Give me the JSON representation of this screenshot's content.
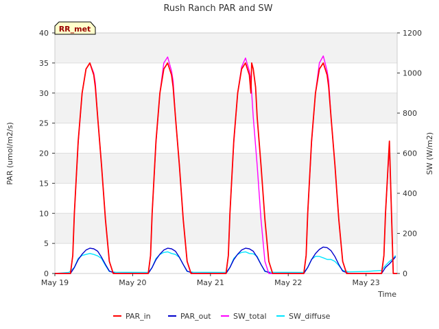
{
  "chart_data": {
    "type": "line",
    "title": "Rush Ranch PAR and SW",
    "station_badge": "RR_met",
    "xlabel": "Time",
    "ylabel_left": "PAR (umol/m2/s)",
    "ylabel_right": "SW (W/m2)",
    "xlim": [
      0,
      4.4
    ],
    "ylim_left": [
      0,
      40
    ],
    "ylim_right": [
      0,
      1200
    ],
    "x_ticks": [
      {
        "value": 0,
        "label": "May 19"
      },
      {
        "value": 1,
        "label": "May 20"
      },
      {
        "value": 2,
        "label": "May 21"
      },
      {
        "value": 3,
        "label": "May 22"
      },
      {
        "value": 4,
        "label": "May 23"
      }
    ],
    "y_ticks_left": [
      0,
      5,
      10,
      15,
      20,
      25,
      30,
      35,
      40
    ],
    "y_ticks_right": [
      0,
      200,
      400,
      600,
      800,
      1000,
      1200
    ],
    "grid": true,
    "shaded_bands_left": [
      [
        5,
        10
      ],
      [
        15,
        20
      ],
      [
        25,
        30
      ],
      [
        35,
        40
      ]
    ],
    "legend_position": "bottom",
    "series": [
      {
        "name": "PAR_in",
        "color": "#ff0000",
        "axis": "left",
        "x": [
          0,
          0.2,
          0.23,
          0.25,
          0.3,
          0.35,
          0.4,
          0.45,
          0.5,
          0.52,
          0.55,
          0.6,
          0.65,
          0.7,
          0.75,
          0.8,
          0.82,
          1.2,
          1.23,
          1.25,
          1.3,
          1.35,
          1.4,
          1.45,
          1.5,
          1.52,
          1.55,
          1.6,
          1.65,
          1.7,
          1.75,
          1.8,
          1.82,
          2.2,
          2.23,
          2.25,
          2.3,
          2.35,
          2.4,
          2.45,
          2.5,
          2.52,
          2.53,
          2.55,
          2.58,
          2.6,
          2.65,
          2.7,
          2.75,
          2.8,
          2.82,
          3.2,
          3.23,
          3.25,
          3.3,
          3.35,
          3.4,
          3.45,
          3.5,
          3.52,
          3.55,
          3.6,
          3.65,
          3.7,
          3.75,
          3.8,
          3.82,
          4.2,
          4.23,
          4.25,
          4.3,
          4.35,
          4.4
        ],
        "y": [
          0,
          0,
          3,
          10,
          22,
          30,
          34,
          35,
          33,
          31,
          26,
          18,
          9,
          2,
          0,
          0,
          0,
          0,
          3,
          10,
          22,
          30,
          34,
          35,
          33,
          31,
          26,
          18,
          9,
          2,
          0,
          0,
          0,
          0,
          3,
          10,
          22,
          30,
          34,
          35,
          33,
          30,
          35,
          34,
          31,
          26,
          18,
          9,
          2,
          0,
          0,
          0,
          3,
          10,
          22,
          30,
          34,
          35,
          33,
          31,
          26,
          18,
          9,
          2,
          0,
          0,
          0,
          0,
          3,
          10,
          22,
          0,
          0
        ]
      },
      {
        "name": "PAR_out",
        "color": "#0000cc",
        "axis": "left",
        "x": [
          0,
          0.2,
          0.25,
          0.3,
          0.35,
          0.4,
          0.45,
          0.5,
          0.55,
          0.6,
          0.65,
          0.7,
          0.78,
          1.2,
          1.25,
          1.3,
          1.35,
          1.4,
          1.45,
          1.5,
          1.55,
          1.6,
          1.65,
          1.7,
          1.78,
          2.2,
          2.25,
          2.3,
          2.35,
          2.4,
          2.45,
          2.5,
          2.55,
          2.6,
          2.65,
          2.7,
          2.78,
          3.2,
          3.25,
          3.3,
          3.35,
          3.4,
          3.45,
          3.5,
          3.55,
          3.6,
          3.65,
          3.7,
          3.78,
          4.2,
          4.25,
          4.3,
          4.35,
          4.38
        ],
        "y": [
          0,
          0,
          1.0,
          2.3,
          3.2,
          3.9,
          4.2,
          4.1,
          3.7,
          2.7,
          1.5,
          0.4,
          0,
          0,
          1.0,
          2.3,
          3.2,
          3.9,
          4.2,
          4.1,
          3.7,
          2.7,
          1.5,
          0.4,
          0,
          0,
          1.0,
          2.3,
          3.2,
          3.9,
          4.2,
          4.1,
          3.7,
          2.7,
          1.5,
          0.4,
          0,
          0,
          1.0,
          2.3,
          3.3,
          4.0,
          4.4,
          4.3,
          3.8,
          2.8,
          1.5,
          0.4,
          0,
          0,
          1.0,
          1.6,
          2.3,
          2.8
        ]
      },
      {
        "name": "SW_total",
        "color": "#ff00ff",
        "axis": "right",
        "x": [
          0,
          0.2,
          0.23,
          0.25,
          0.3,
          0.35,
          0.4,
          0.45,
          0.5,
          0.52,
          0.55,
          0.6,
          0.65,
          0.7,
          0.75,
          0.8,
          0.82,
          1.2,
          1.23,
          1.25,
          1.3,
          1.35,
          1.4,
          1.45,
          1.5,
          1.52,
          1.55,
          1.6,
          1.65,
          1.7,
          1.75,
          1.8,
          1.82,
          2.2,
          2.23,
          2.25,
          2.3,
          2.35,
          2.4,
          2.45,
          2.5,
          2.52,
          2.55,
          2.6,
          2.65,
          2.7,
          2.75,
          2.8,
          2.82,
          3.2,
          3.23,
          3.25,
          3.3,
          3.35,
          3.4,
          3.45,
          3.5,
          3.52,
          3.55,
          3.6,
          3.65,
          3.7,
          3.75,
          3.8,
          3.82,
          4.2,
          4.23,
          4.25,
          4.3,
          4.35,
          4.4
        ],
        "y": [
          0,
          0,
          90,
          300,
          650,
          900,
          1020,
          1050,
          1000,
          950,
          780,
          540,
          270,
          60,
          0,
          0,
          0,
          0,
          90,
          300,
          650,
          900,
          1050,
          1080,
          1010,
          960,
          780,
          540,
          270,
          60,
          0,
          0,
          0,
          0,
          90,
          300,
          650,
          900,
          1030,
          1075,
          1010,
          960,
          780,
          540,
          270,
          60,
          0,
          0,
          0,
          0,
          90,
          300,
          650,
          900,
          1050,
          1085,
          1010,
          960,
          780,
          540,
          270,
          60,
          0,
          0,
          0,
          0,
          90,
          300,
          640,
          0,
          0
        ]
      },
      {
        "name": "SW_diffuse",
        "color": "#00e5ff",
        "axis": "right",
        "x": [
          0,
          0.18,
          0.25,
          0.3,
          0.35,
          0.4,
          0.45,
          0.5,
          0.55,
          0.6,
          0.65,
          0.7,
          0.78,
          1.2,
          1.25,
          1.3,
          1.35,
          1.4,
          1.45,
          1.5,
          1.55,
          1.6,
          1.65,
          1.7,
          1.78,
          2.2,
          2.25,
          2.3,
          2.35,
          2.4,
          2.45,
          2.5,
          2.55,
          2.6,
          2.65,
          2.7,
          2.78,
          3.2,
          3.25,
          3.3,
          3.35,
          3.4,
          3.45,
          3.5,
          3.55,
          3.6,
          3.65,
          3.7,
          3.78,
          4.0,
          4.2,
          4.25,
          4.3,
          4.35,
          4.38
        ],
        "y": [
          0,
          5,
          30,
          75,
          90,
          95,
          100,
          95,
          88,
          75,
          40,
          10,
          6,
          5,
          30,
          75,
          95,
          105,
          108,
          100,
          95,
          80,
          45,
          10,
          6,
          5,
          30,
          75,
          95,
          105,
          108,
          100,
          98,
          85,
          45,
          10,
          6,
          5,
          30,
          70,
          85,
          85,
          78,
          70,
          70,
          60,
          40,
          15,
          8,
          10,
          15,
          40,
          60,
          75,
          90
        ]
      }
    ]
  }
}
